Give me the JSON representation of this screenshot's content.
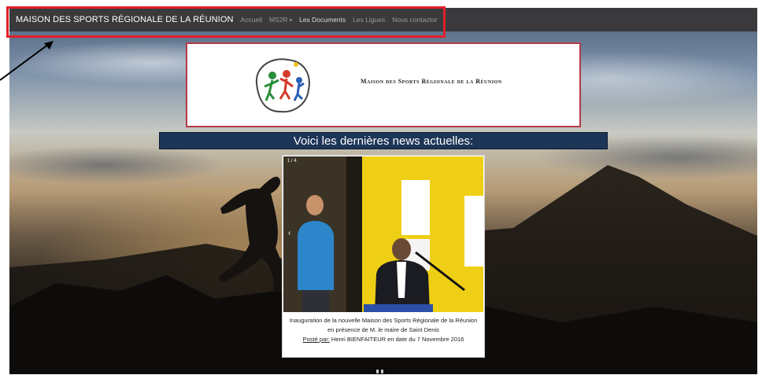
{
  "navbar": {
    "brand": "MAISON DES SPORTS RÉGIONALE DE LA RÉUNION",
    "links": [
      {
        "label": "Accueil"
      },
      {
        "label": "MS2R"
      },
      {
        "label": "Les Documents"
      },
      {
        "label": "Les Ligues"
      },
      {
        "label": "Nous contactor"
      }
    ],
    "dropdown_caret": "▾"
  },
  "banner": {
    "title": "Maison des Sports Régionale de la Réunion"
  },
  "news": {
    "heading": "Voici les dernières news actuelles:",
    "slide": {
      "counter": "1 / 4",
      "prev_icon": "‹",
      "next_icon": "›",
      "caption_line": "Inauguration de la nouvelle Maison des Sports Régionale de la Réunion en présence de M. le maire de Saint Denis",
      "posted_label": "Posté par:",
      "posted_by": " Henri BIENFAITEUR en date du 7 Novembre 2016"
    }
  },
  "colors": {
    "navbar_bg": "#3a3a3c",
    "highlight_border": "#e3202a",
    "heading_bg": "#1d3557",
    "banner_border": "#b23a48"
  }
}
